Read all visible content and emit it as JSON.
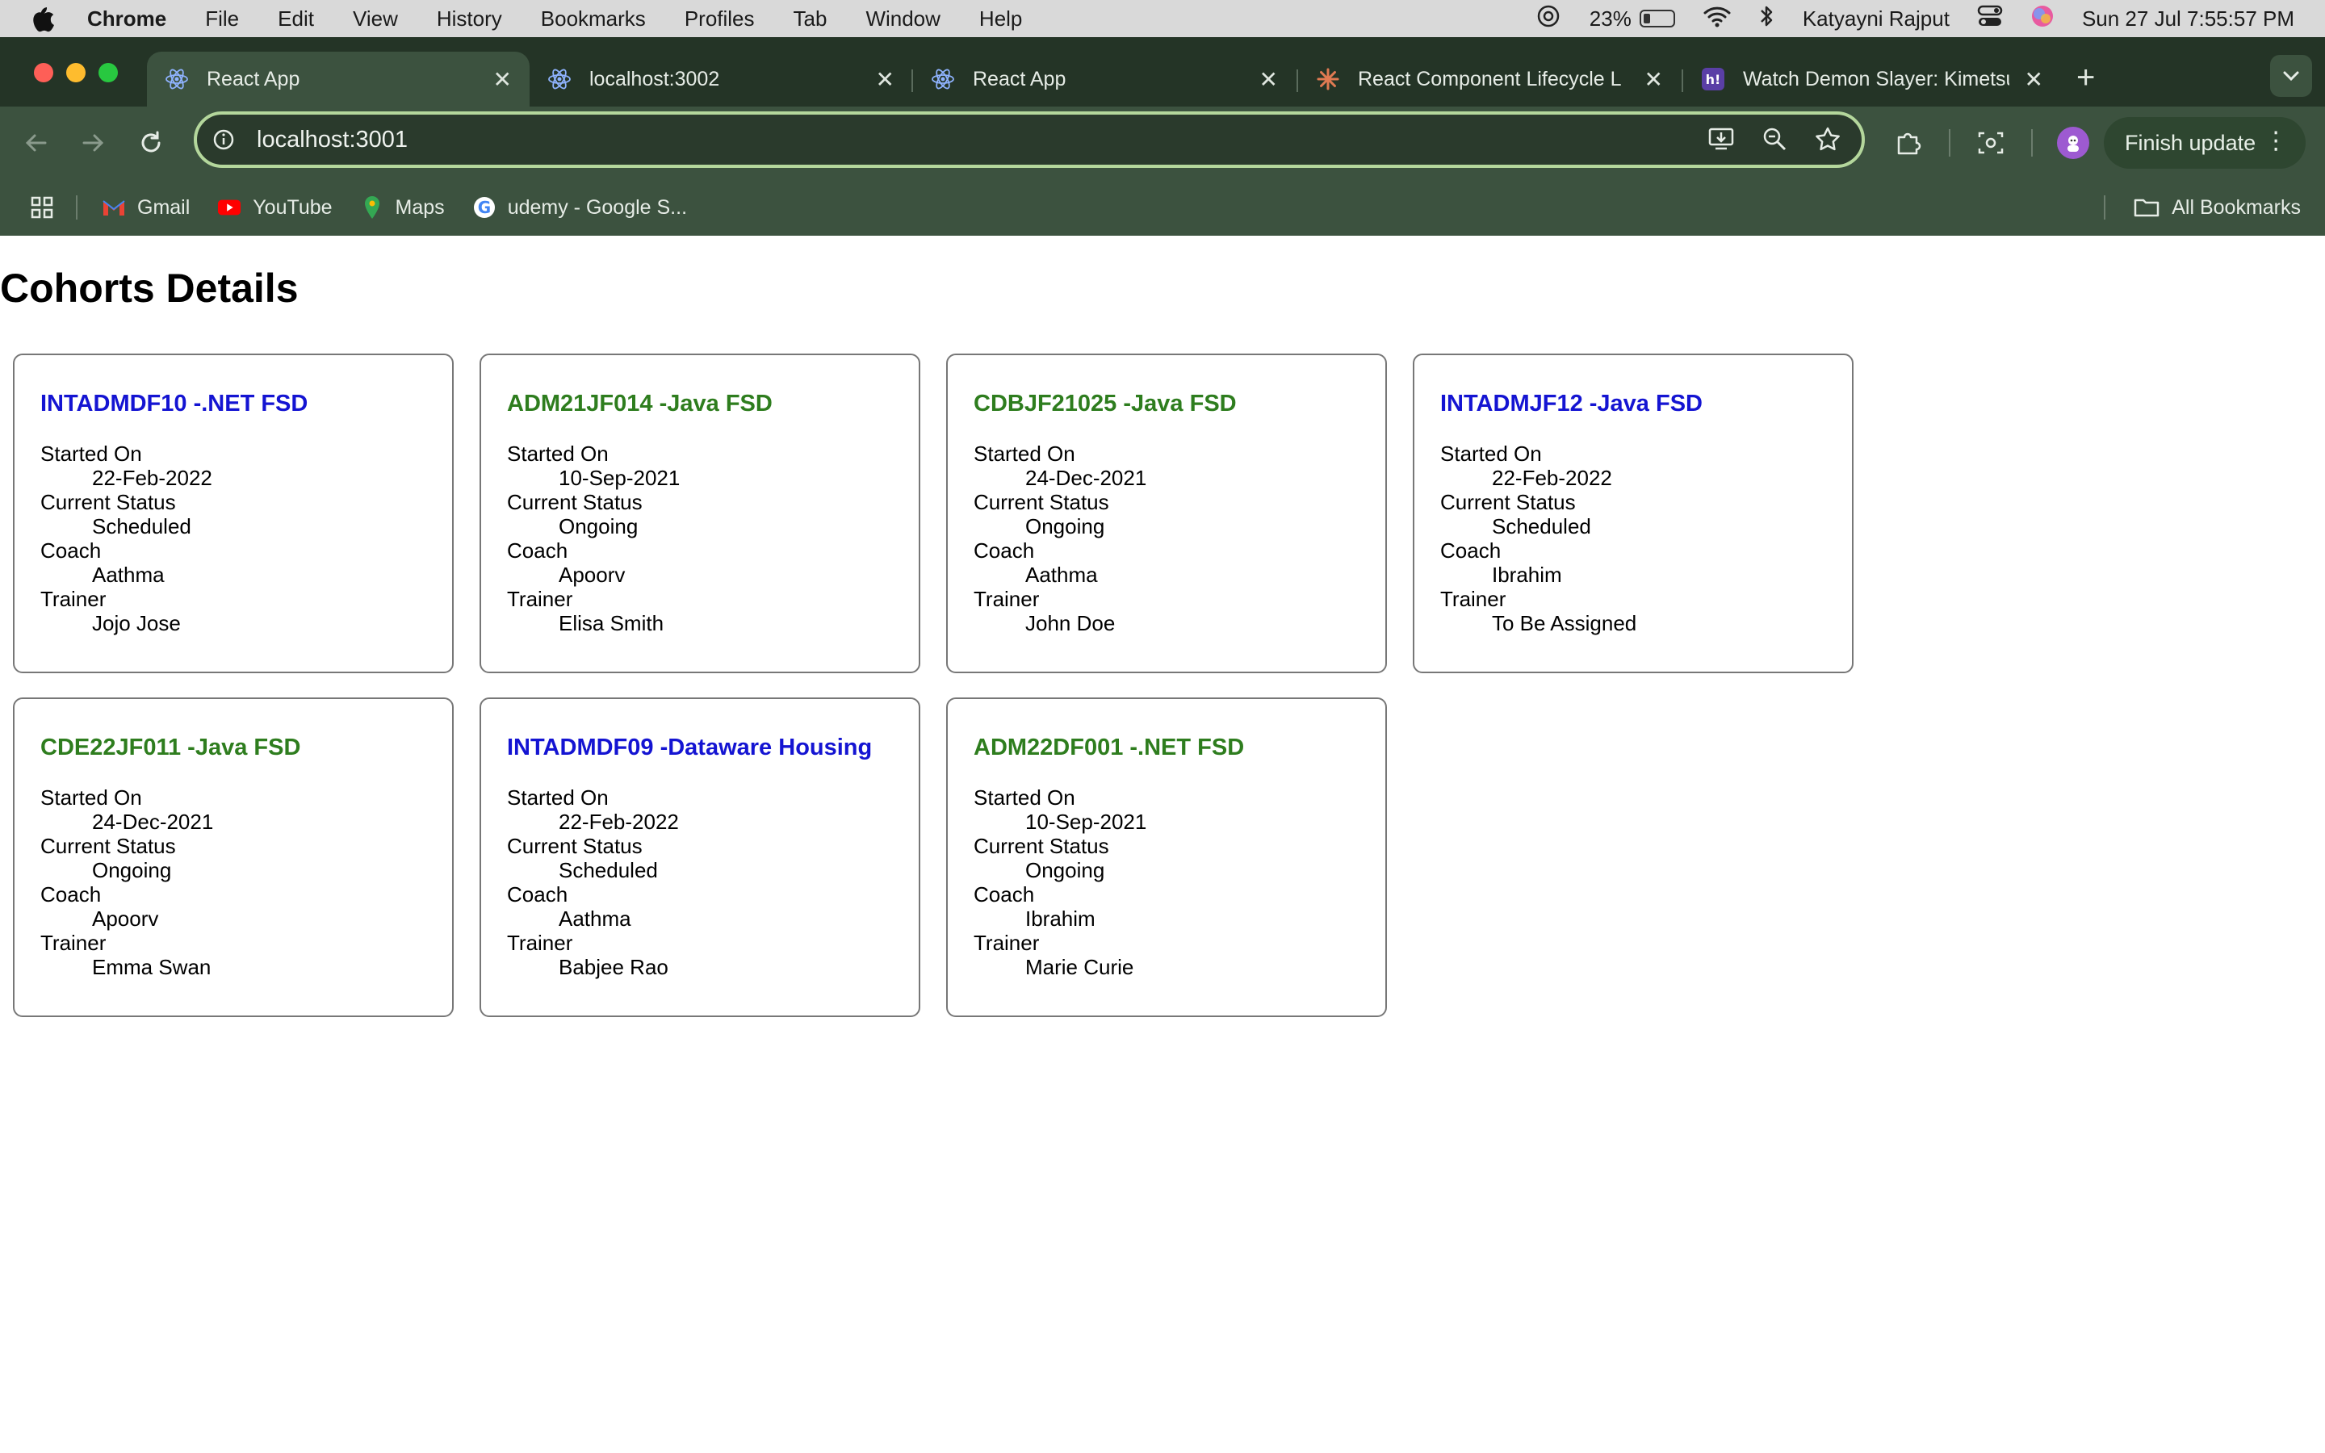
{
  "menubar": {
    "app": "Chrome",
    "items": [
      "File",
      "Edit",
      "View",
      "History",
      "Bookmarks",
      "Profiles",
      "Tab",
      "Window",
      "Help"
    ],
    "battery_percent": "23%",
    "battery_level": 0.23,
    "user": "Katyayni Rajput",
    "clock": "Sun 27 Jul  7:55:57 PM"
  },
  "tabs": [
    {
      "title": "React App",
      "icon": "react-icon"
    },
    {
      "title": "localhost:3002",
      "icon": "react-icon"
    },
    {
      "title": "React App",
      "icon": "react-icon"
    },
    {
      "title": "React Component Lifecycle L",
      "icon": "claude-icon"
    },
    {
      "title": "Watch Demon Slayer: Kimetsu",
      "icon": "hianime-icon"
    }
  ],
  "toolbar": {
    "url": "localhost:3001",
    "finish_update": "Finish update"
  },
  "bookmarks": {
    "items": [
      "Gmail",
      "YouTube",
      "Maps",
      "udemy - Google S..."
    ],
    "all": "All Bookmarks"
  },
  "page": {
    "title": "Cohorts Details",
    "field_labels": {
      "started": "Started On",
      "status": "Current Status",
      "coach": "Coach",
      "trainer": "Trainer"
    },
    "colors": {
      "ongoing": "#2e7d1e",
      "scheduled": "#1414d2"
    },
    "cohorts": [
      {
        "name": "INTADMDF10 -.NET FSD",
        "started": "22-Feb-2022",
        "status": "Scheduled",
        "coach": "Aathma",
        "trainer": "Jojo Jose"
      },
      {
        "name": "ADM21JF014 -Java FSD",
        "started": "10-Sep-2021",
        "status": "Ongoing",
        "coach": "Apoorv",
        "trainer": "Elisa Smith"
      },
      {
        "name": "CDBJF21025 -Java FSD",
        "started": "24-Dec-2021",
        "status": "Ongoing",
        "coach": "Aathma",
        "trainer": "John Doe"
      },
      {
        "name": "INTADMJF12 -Java FSD",
        "started": "22-Feb-2022",
        "status": "Scheduled",
        "coach": "Ibrahim",
        "trainer": "To Be Assigned"
      },
      {
        "name": "CDE22JF011 -Java FSD",
        "started": "24-Dec-2021",
        "status": "Ongoing",
        "coach": "Apoorv",
        "trainer": "Emma Swan"
      },
      {
        "name": "INTADMDF09 -Dataware Housing",
        "started": "22-Feb-2022",
        "status": "Scheduled",
        "coach": "Aathma",
        "trainer": "Babjee Rao"
      },
      {
        "name": "ADM22DF001 -.NET FSD",
        "started": "10-Sep-2021",
        "status": "Ongoing",
        "coach": "Ibrahim",
        "trainer": "Marie Curie"
      }
    ]
  }
}
